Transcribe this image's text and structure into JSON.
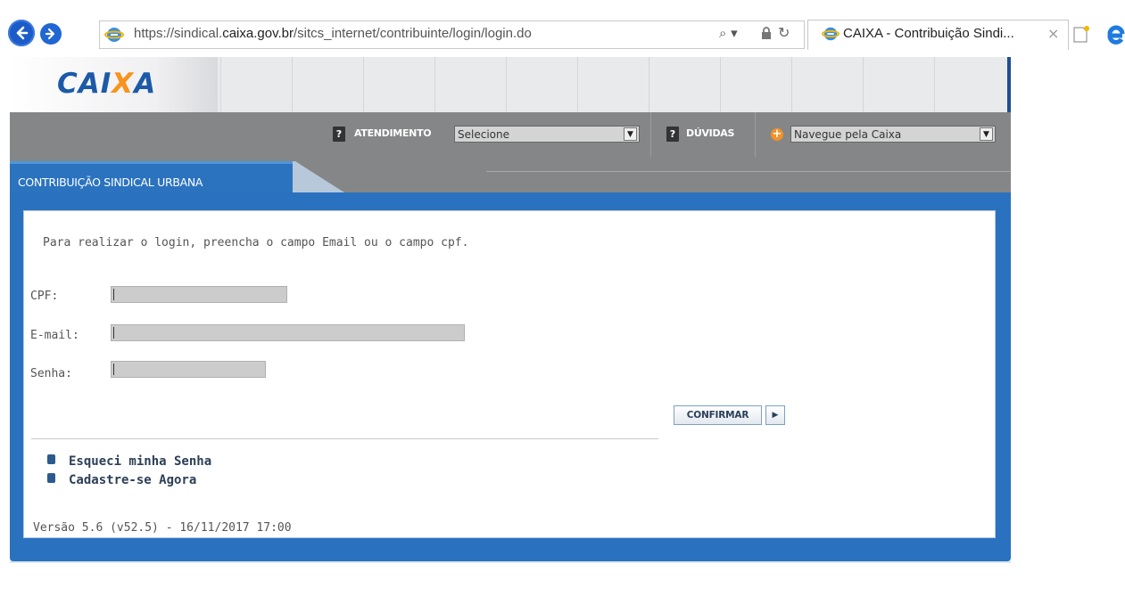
{
  "browser": {
    "url_prefix": "https://sindical.",
    "url_domain": "caixa.gov.br",
    "url_path": "/sitcs_internet/contribuinte/login/login.do",
    "search_glyph": "⌕ ▾",
    "lock_glyph": "🔒",
    "refresh_glyph": "↻",
    "tab_title": "CAIXA - Contribuição Sindi...",
    "tab_close": "×"
  },
  "header": {
    "logo_part1": "CAI",
    "logo_part2": "X",
    "logo_part3": "A",
    "atendimento_label": "ATENDIMENTO",
    "atendimento_selected": "Selecione",
    "duvidas_label": "DÚVIDAS",
    "navegue_selected": "Navegue pela Caixa",
    "select_arrow": "▼",
    "help_glyph": "?"
  },
  "section": {
    "title": "CONTRIBUIÇÃO SINDICAL URBANA"
  },
  "form": {
    "instructions": "Para realizar o login, preencha o campo Email ou o campo cpf.",
    "cpf_label": "CPF:",
    "email_label": "E-mail:",
    "senha_label": "Senha:",
    "cpf_value": "",
    "email_value": "",
    "senha_value": "",
    "confirm_label": "CONFIRMAR",
    "confirm_arrow": "▶"
  },
  "links": {
    "forgot_password": "Esqueci minha Senha",
    "register": "Cadastre-se Agora"
  },
  "footer": {
    "version": "Versão 5.6 (v52.5) - 16/11/2017 17:00"
  },
  "colors": {
    "caixa_blue": "#1c5aa8",
    "caixa_orange": "#f7941d",
    "frame_blue": "#2a72bf",
    "toolbar_gray": "#858687"
  }
}
